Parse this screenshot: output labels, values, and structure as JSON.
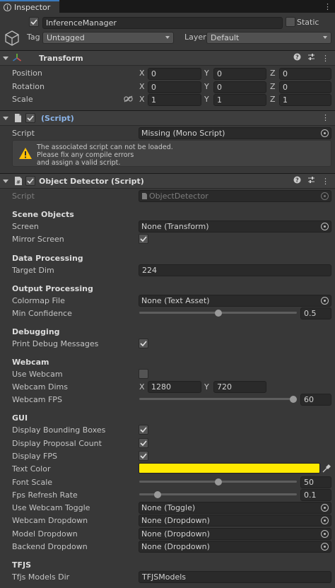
{
  "window": {
    "tab_label": "Inspector"
  },
  "gameobject": {
    "name": "InferenceManager",
    "active": true,
    "static_label": "Static",
    "tag_label": "Tag",
    "tag_value": "Untagged",
    "layer_label": "Layer",
    "layer_value": "Default"
  },
  "transform": {
    "title": "Transform",
    "rows": [
      {
        "label": "Position",
        "x": "0",
        "y": "0",
        "z": "0"
      },
      {
        "label": "Rotation",
        "x": "0",
        "y": "0",
        "z": "0"
      },
      {
        "label": "Scale",
        "x": "1",
        "y": "1",
        "z": "1"
      }
    ],
    "axis_x": "X",
    "axis_y": "Y",
    "axis_z": "Z"
  },
  "missing_script": {
    "title": "(Script)",
    "script_label": "Script",
    "script_value": "Missing (Mono Script)",
    "warning_lines": [
      "The associated script can not be loaded.",
      "Please fix any compile errors",
      "and assign a valid script."
    ]
  },
  "object_detector": {
    "title": "Object Detector (Script)",
    "script_label": "Script",
    "script_value": "ObjectDetector",
    "sections": {
      "scene_objects": "Scene Objects",
      "data_processing": "Data Processing",
      "output_processing": "Output Processing",
      "debugging": "Debugging",
      "webcam": "Webcam",
      "gui": "GUI",
      "tfjs": "TFJS"
    },
    "screen_label": "Screen",
    "screen_value": "None (Transform)",
    "mirror_label": "Mirror Screen",
    "mirror_checked": true,
    "target_dim_label": "Target Dim",
    "target_dim_value": "224",
    "colormap_label": "Colormap File",
    "colormap_value": "None (Text Asset)",
    "min_conf_label": "Min Confidence",
    "min_conf_value": "0.5",
    "min_conf_fraction": 0.5,
    "print_debug_label": "Print Debug Messages",
    "print_debug_checked": true,
    "use_webcam_label": "Use Webcam",
    "use_webcam_checked": false,
    "webcam_dims_label": "Webcam Dims",
    "webcam_dims_x": "1280",
    "webcam_dims_y": "720",
    "webcam_fps_label": "Webcam FPS",
    "webcam_fps_value": "60",
    "webcam_fps_fraction": 1.0,
    "display_boxes_label": "Display Bounding Boxes",
    "display_boxes_checked": true,
    "display_proposal_label": "Display Proposal Count",
    "display_proposal_checked": true,
    "display_fps_label": "Display FPS",
    "display_fps_checked": true,
    "text_color_label": "Text Color",
    "text_color_hex": "#ffea00",
    "font_scale_label": "Font Scale",
    "font_scale_value": "50",
    "font_scale_fraction": 0.5,
    "fps_refresh_label": "Fps Refresh Rate",
    "fps_refresh_value": "0.1",
    "fps_refresh_fraction": 0.1,
    "use_webcam_toggle_label": "Use Webcam Toggle",
    "use_webcam_toggle_value": "None (Toggle)",
    "webcam_dropdown_label": "Webcam Dropdown",
    "webcam_dropdown_value": "None (Dropdown)",
    "model_dropdown_label": "Model Dropdown",
    "model_dropdown_value": "None (Dropdown)",
    "backend_dropdown_label": "Backend Dropdown",
    "backend_dropdown_value": "None (Dropdown)",
    "tfjs_dir_label": "Tfjs Models Dir",
    "tfjs_dir_value": "TFJSModels"
  },
  "colors": {
    "accent": "#3a79bb",
    "warning": "#ffc107",
    "text_color_swatch": "#ffea00"
  }
}
